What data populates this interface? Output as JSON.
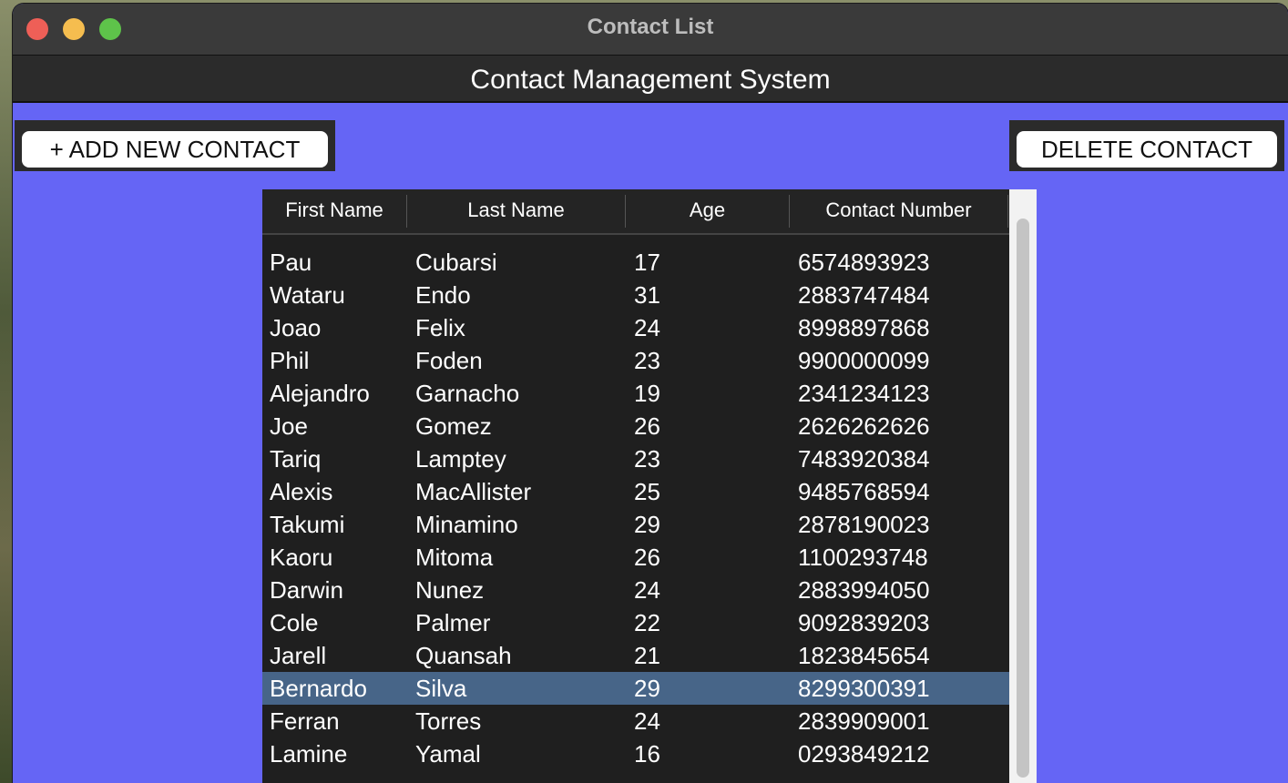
{
  "window": {
    "title": "Contact List"
  },
  "app": {
    "heading": "Contact Management System"
  },
  "toolbar": {
    "add_label": "+ ADD NEW CONTACT",
    "delete_label": "DELETE CONTACT"
  },
  "table": {
    "columns": [
      "First Name",
      "Last Name",
      "Age",
      "Contact Number"
    ],
    "rows": [
      [
        "Pau",
        "Cubarsi",
        "17",
        "6574893923"
      ],
      [
        "Wataru",
        "Endo",
        "31",
        "2883747484"
      ],
      [
        "Joao",
        "Felix",
        "24",
        "8998897868"
      ],
      [
        "Phil",
        "Foden",
        "23",
        "9900000099"
      ],
      [
        "Alejandro",
        "Garnacho",
        "19",
        "2341234123"
      ],
      [
        "Joe",
        "Gomez",
        "26",
        "2626262626"
      ],
      [
        "Tariq",
        "Lamptey",
        "23",
        "7483920384"
      ],
      [
        "Alexis",
        "MacAllister",
        "25",
        "9485768594"
      ],
      [
        "Takumi",
        "Minamino",
        "29",
        "2878190023"
      ],
      [
        "Kaoru",
        "Mitoma",
        "26",
        "1100293748"
      ],
      [
        "Darwin",
        "Nunez",
        "24",
        "2883994050"
      ],
      [
        "Cole",
        "Palmer",
        "22",
        "9092839203"
      ],
      [
        "Jarell",
        "Quansah",
        "21",
        "1823845654"
      ],
      [
        "Bernardo",
        "Silva",
        "29",
        "8299300391"
      ],
      [
        "Ferran",
        "Torres",
        "24",
        "2839909001"
      ],
      [
        "Lamine",
        "Yamal",
        "16",
        "0293849212"
      ]
    ],
    "selected_row": 13
  },
  "colors": {
    "background": "#6565f5",
    "header_bg": "#2b2b2b",
    "table_bg": "#1f1f1f",
    "selected_row": "#476588"
  }
}
